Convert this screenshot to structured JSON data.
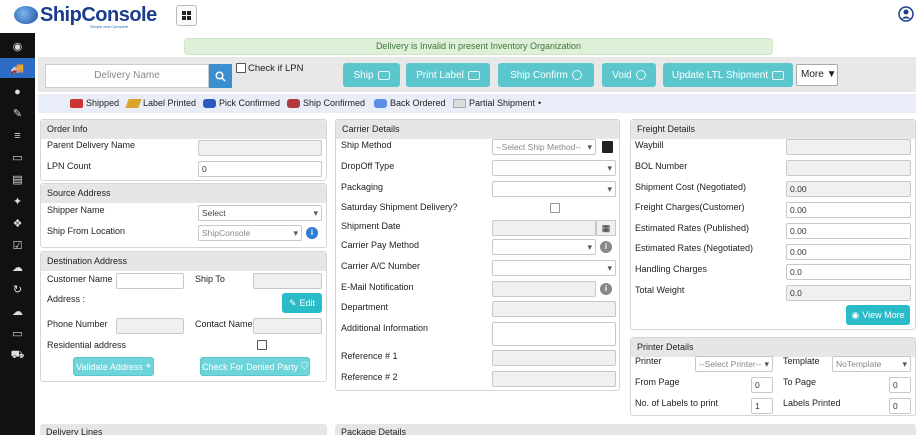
{
  "app": {
    "brand": "ShipConsole",
    "tagline": "Simple and Complete"
  },
  "alert": "Delivery is Invalid in present Inventory Organization",
  "toolbar": {
    "delivery_placeholder": "Delivery Name",
    "lpn_label": "Check if LPN",
    "buttons": [
      "Ship",
      "Print Label",
      "Ship Confirm",
      "Void",
      "Update LTL Shipment"
    ],
    "more_label": "More"
  },
  "legend": [
    "Shipped",
    "Label Printed",
    "Pick Confirmed",
    "Ship Confirmed",
    "Back Ordered",
    "Partial Shipment"
  ],
  "order_info": {
    "title": "Order Info",
    "parent_delivery_label": "Parent Delivery Name",
    "lpn_count_label": "LPN Count",
    "lpn_count_value": "0"
  },
  "source_address": {
    "title": "Source Address",
    "shipper_label": "Shipper Name",
    "shipper_value": "Select",
    "ship_from_label": "Ship From Location",
    "ship_from_value": "ShipConsole"
  },
  "destination_address": {
    "title": "Destination Address",
    "customer_label": "Customer Name",
    "ship_to_label": "Ship To",
    "address_label": "Address :",
    "edit_label": "Edit",
    "phone_label": "Phone Number",
    "contact_label": "Contact Name",
    "residential_label": "Residential address",
    "validate_label": "Validate Address",
    "denied_label": "Check For Denied Party"
  },
  "carrier_details": {
    "title": "Carrier Details",
    "ship_method_label": "Ship Method",
    "ship_method_value": "--Select Ship Method--",
    "dropoff_label": "DropOff Type",
    "packaging_label": "Packaging",
    "saturday_label": "Saturday Shipment Delivery?",
    "ship_date_label": "Shipment Date",
    "pay_method_label": "Carrier Pay Method",
    "account_label": "Carrier A/C Number",
    "email_label": "E-Mail Notification",
    "department_label": "Department",
    "additional_label": "Additional Information",
    "ref1_label": "Reference # 1",
    "ref2_label": "Reference # 2"
  },
  "freight_details": {
    "title": "Freight Details",
    "waybill_label": "Waybill",
    "bol_label": "BOL Number",
    "cost_label": "Shipment Cost (Negotiated)",
    "cost_value": "0.00",
    "charges_label": "Freight Charges(Customer)",
    "charges_value": "0.00",
    "est_pub_label": "Estimated Rates (Published)",
    "est_pub_value": "0.00",
    "est_neg_label": "Estimated Rates (Negotiated)",
    "est_neg_value": "0.00",
    "handling_label": "Handling Charges",
    "handling_value": "0.0",
    "weight_label": "Total Weight",
    "weight_value": "0.0",
    "view_more_label": "View More"
  },
  "printer_details": {
    "title": "Printer Details",
    "printer_label": "Printer",
    "printer_value": "--Select Printer--",
    "template_label": "Template",
    "template_value": "NoTemplate",
    "from_page_label": "From Page",
    "from_page_value": "0",
    "to_page_label": "To Page",
    "to_page_value": "0",
    "labels_print_label": "No. of Labels to print",
    "labels_print_value": "1",
    "labels_printed_label": "Labels Printed",
    "labels_printed_value": "0"
  },
  "bottom": {
    "delivery_lines": "Delivery Lines",
    "package_details": "Package Details"
  }
}
